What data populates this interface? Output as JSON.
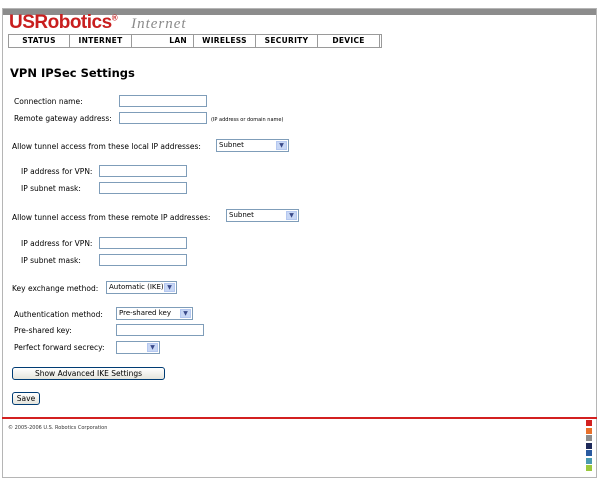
{
  "brand": {
    "logo": "USRobotics",
    "logo_mark": "®",
    "product": "Internet"
  },
  "nav": [
    {
      "label": "STATUS"
    },
    {
      "label": "INTERNET"
    },
    {
      "label": "LAN"
    },
    {
      "label": "WIRELESS"
    },
    {
      "label": "SECURITY"
    },
    {
      "label": "DEVICE"
    }
  ],
  "page": {
    "title": "VPN IPSec Settings"
  },
  "form": {
    "connection_name": {
      "label": "Connection name:",
      "value": ""
    },
    "remote_gateway": {
      "label": "Remote gateway address:",
      "value": "",
      "hint": "(IP address or domain name)"
    },
    "local_access": {
      "label": "Allow tunnel access from these local IP addresses:",
      "selected": "Subnet",
      "ip_label": "IP address for VPN:",
      "mask_label": "IP subnet mask:"
    },
    "remote_access": {
      "label": "Allow tunnel access from these remote IP addresses:",
      "selected": "Subnet",
      "ip_label": "IP address for VPN:",
      "mask_label": "IP subnet mask:"
    },
    "key_exchange": {
      "label": "Key exchange method:",
      "selected": "Automatic (IKE)"
    },
    "auth_method": {
      "label": "Authentication method:",
      "selected": "Pre-shared key"
    },
    "preshared_key": {
      "label": "Pre-shared key:",
      "value": ""
    },
    "pfs": {
      "label": "Perfect forward secrecy:",
      "selected": ""
    },
    "advanced_button": "Show Advanced IKE Settings",
    "save_button": "Save"
  },
  "footer": {
    "copyright": "© 2005-2006 U.S. Robotics Corporation"
  },
  "colors": {
    "brand_red": "#c81e1e",
    "divider_red": "#d32020",
    "swatches": [
      "#d32020",
      "#e8702a",
      "#8c8c8c",
      "#1e2a5a",
      "#2a5aa0",
      "#4a9ab0",
      "#9ac83c"
    ]
  }
}
